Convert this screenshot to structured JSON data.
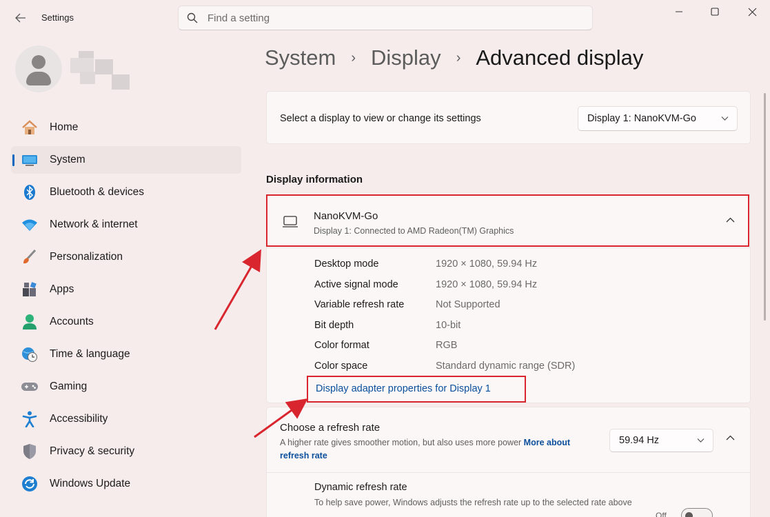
{
  "window": {
    "app_title": "Settings",
    "search_placeholder": "Find a setting"
  },
  "sidebar": {
    "items": [
      {
        "label": "Home",
        "icon": "home-icon"
      },
      {
        "label": "System",
        "icon": "system-icon",
        "active": true
      },
      {
        "label": "Bluetooth & devices",
        "icon": "bluetooth-icon"
      },
      {
        "label": "Network & internet",
        "icon": "wifi-icon"
      },
      {
        "label": "Personalization",
        "icon": "brush-icon"
      },
      {
        "label": "Apps",
        "icon": "apps-icon"
      },
      {
        "label": "Accounts",
        "icon": "person-icon"
      },
      {
        "label": "Time & language",
        "icon": "globe-clock-icon"
      },
      {
        "label": "Gaming",
        "icon": "gamepad-icon"
      },
      {
        "label": "Accessibility",
        "icon": "accessibility-icon"
      },
      {
        "label": "Privacy & security",
        "icon": "shield-icon"
      },
      {
        "label": "Windows Update",
        "icon": "update-icon"
      }
    ]
  },
  "breadcrumb": {
    "items": [
      "System",
      "Display"
    ],
    "current": "Advanced display"
  },
  "display_select": {
    "label": "Select a display to view or change its settings",
    "value": "Display 1: NanoKVM-Go"
  },
  "display_info": {
    "section_title": "Display information",
    "name": "NanoKVM-Go",
    "subtitle": "Display 1: Connected to AMD Radeon(TM) Graphics",
    "rows": [
      {
        "key": "Desktop mode",
        "value": "1920 × 1080, 59.94 Hz"
      },
      {
        "key": "Active signal mode",
        "value": "1920 × 1080, 59.94 Hz"
      },
      {
        "key": "Variable refresh rate",
        "value": "Not Supported"
      },
      {
        "key": "Bit depth",
        "value": "10-bit"
      },
      {
        "key": "Color format",
        "value": "RGB"
      },
      {
        "key": "Color space",
        "value": "Standard dynamic range (SDR)"
      }
    ],
    "adapter_link": "Display adapter properties for Display 1"
  },
  "refresh_rate": {
    "title": "Choose a refresh rate",
    "description": "A higher rate gives smoother motion, but also uses more power",
    "more_link": "More about refresh rate",
    "value": "59.94 Hz",
    "dynamic_title": "Dynamic refresh rate",
    "dynamic_desc": "To help save power, Windows adjusts the refresh rate up to the selected rate above",
    "toggle_label": "Off"
  },
  "colors": {
    "accent": "#0067c0",
    "annotation_red": "#d9262e",
    "link": "#0b4f9c"
  }
}
